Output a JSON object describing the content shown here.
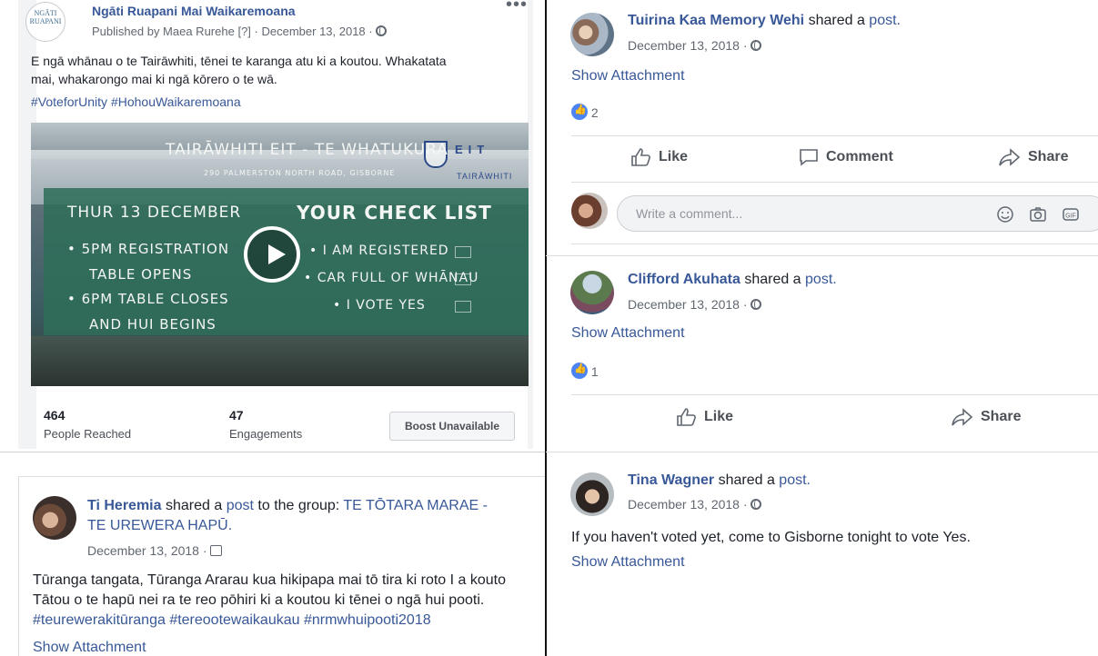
{
  "post_main": {
    "page_name": "Ngāti Ruapani Mai Waikaremoana",
    "published_by": "Published by Maea Rurehe",
    "help_mark": "[?]",
    "date": "December 13, 2018",
    "text_line1": "E ngā whānau o te Tairāwhiti, tēnei te karanga atu ki a koutou. Whakatata",
    "text_line2": "mai, whakarongo mai ki ngā kōrero o te wā.",
    "hashtags": "#VoteforUnity #HohouWaikaremoana",
    "logo_text": "NGĀTI RUAPANI",
    "video": {
      "title": "TAIRĀWHITI EIT - TE WHATUKURA",
      "address": "290 PALMERSTON NORTH ROAD, GISBORNE",
      "date_line": "THUR 13 DECEMBER",
      "bullets_left": [
        "• 5PM REGISTRATION",
        "TABLE OPENS",
        "• 6PM TABLE CLOSES",
        "AND HUI BEGINS"
      ],
      "checklist_title": "YOUR CHECK LIST",
      "checklist": [
        "• I AM REGISTERED",
        "• CAR FULL OF WHĀNAU",
        "• I VOTE YES"
      ],
      "eit_label": "EIT",
      "eit_sub": "TAIRĀWHITI"
    },
    "reached_count": "464",
    "reached_label": "People Reached",
    "engagements_count": "47",
    "engagements_label": "Engagements",
    "boost_label": "Boost Unavailable"
  },
  "post_ti": {
    "author": "Ti Heremia",
    "shared_a": "shared a",
    "post_word": "post",
    "to_group": "to the group:",
    "group_name_1": "TE TŌTARA MARAE -",
    "group_name_2": "TE UREWERA HAPŪ.",
    "date": "December 13, 2018",
    "text_line1": "Tūranga tangata, Tūranga Ararau kua hikipapa mai tō tira ki roto I a kouto",
    "text_line2": "Tātou o te hapū nei ra te reo pōhiri ki a koutou ki tēnei o ngā hui pooti.",
    "hashtags": "#teurewerakitūranga #tereootewaikaukau #nrmwhuipooti2018",
    "show_attachment": "Show Attachment"
  },
  "post_tuirina": {
    "author": "Tuirina Kaa Memory Wehi",
    "shared_a": "shared a",
    "post_word": "post.",
    "date": "December 13, 2018",
    "show_attachment": "Show Attachment",
    "like_count": "2",
    "actions": {
      "like": "Like",
      "comment": "Comment",
      "share": "Share"
    },
    "comment_placeholder": "Write a comment..."
  },
  "post_clifford": {
    "author": "Clifford Akuhata",
    "shared_a": "shared a",
    "post_word": "post.",
    "date": "December 13, 2018",
    "show_attachment": "Show Attachment",
    "like_count": "1",
    "actions": {
      "like": "Like",
      "share": "Share"
    }
  },
  "post_tina": {
    "author": "Tina Wagner",
    "shared_a": "shared a",
    "post_word": "post.",
    "date": "December 13, 2018",
    "text": "If you haven't voted yet, come to Gisborne tonight to vote Yes.",
    "show_attachment": "Show Attachment"
  },
  "colors": {
    "link": "#385898",
    "like_blue": "#4c84f3",
    "divider": "#111111"
  },
  "icons": [
    "globe-icon",
    "group-icon",
    "play-icon",
    "like-icon",
    "comment-icon",
    "share-icon",
    "emoji-icon",
    "camera-icon",
    "gif-icon",
    "more-icon"
  ]
}
